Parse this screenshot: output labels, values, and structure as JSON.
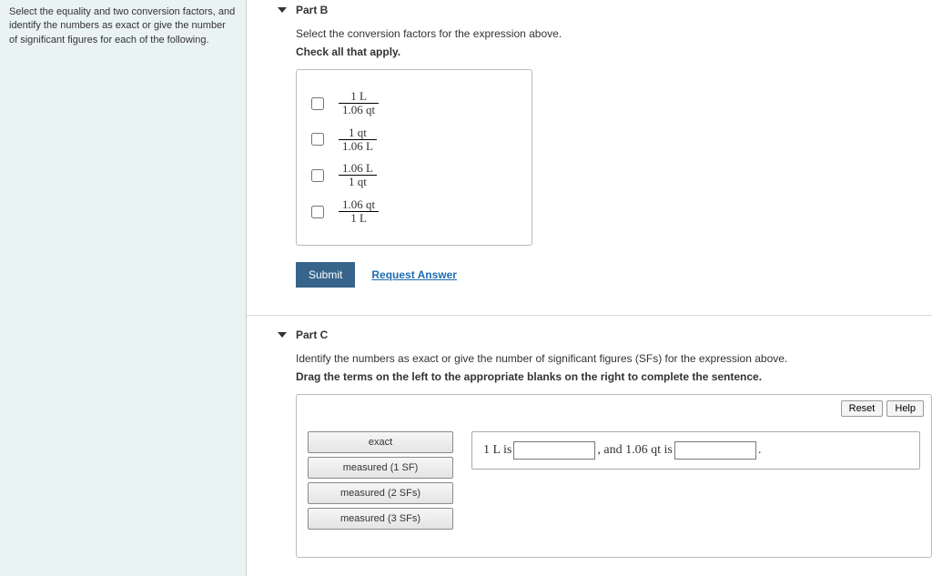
{
  "sidebar": {
    "prompt": "Select the equality and two conversion factors, and identify the numbers as exact or give the number of significant figures for each of the following."
  },
  "partB": {
    "title": "Part B",
    "instruction": "Select the conversion factors for the expression above.",
    "sub": "Check all that apply.",
    "options": [
      {
        "num": "1 L",
        "den": "1.06 qt"
      },
      {
        "num": "1 qt",
        "den": "1.06 L"
      },
      {
        "num": "1.06 L",
        "den": "1 qt"
      },
      {
        "num": "1.06 qt",
        "den": "1 L"
      }
    ],
    "submit": "Submit",
    "request": "Request Answer"
  },
  "partC": {
    "title": "Part C",
    "instruction": "Identify the numbers as exact or give the number of significant figures (SFs) for the expression above.",
    "sub": "Drag the terms on the left to the appropriate blanks on the right to complete the sentence.",
    "reset": "Reset",
    "help": "Help",
    "terms": [
      "exact",
      "measured (1 SF)",
      "measured (2 SFs)",
      "measured (3 SFs)"
    ],
    "sentence": {
      "pre": "1 L is",
      "mid": ", and 1.06 qt is",
      "post": "."
    }
  }
}
